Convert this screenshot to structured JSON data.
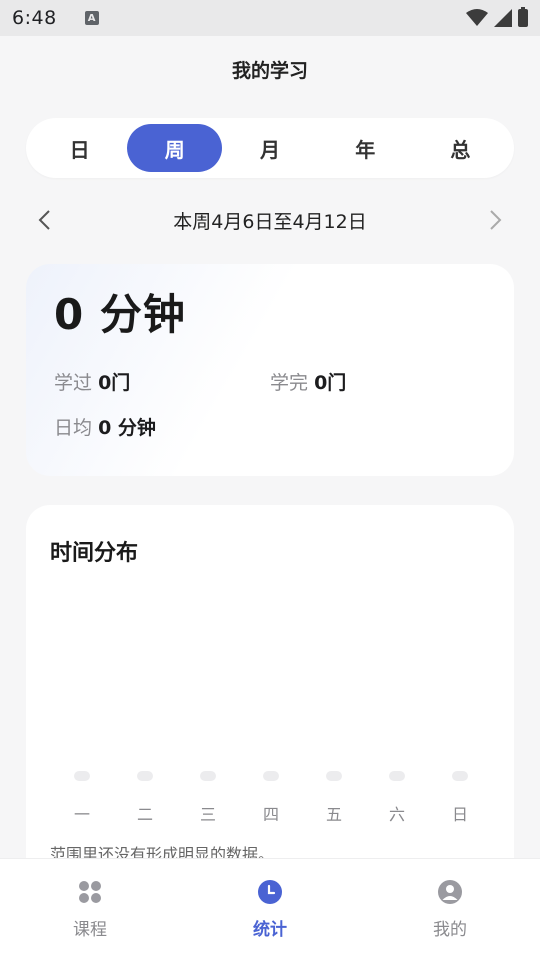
{
  "status_bar": {
    "time": "6:48",
    "notification_letter": "A"
  },
  "header": {
    "title": "我的学习"
  },
  "period_tabs": [
    {
      "label": "日",
      "active": false
    },
    {
      "label": "周",
      "active": true
    },
    {
      "label": "月",
      "active": false
    },
    {
      "label": "年",
      "active": false
    },
    {
      "label": "总",
      "active": false
    }
  ],
  "date_nav": {
    "range_label": "本周4月6日至4月12日"
  },
  "summary": {
    "total_label": "0 分钟",
    "studied_label": "学过",
    "studied_value": "0门",
    "completed_label": "学完",
    "completed_value": "0门",
    "daily_avg_label": "日均",
    "daily_avg_value": "0 分钟"
  },
  "distribution": {
    "title": "时间分布",
    "days": [
      "一",
      "二",
      "三",
      "四",
      "五",
      "六",
      "日"
    ],
    "values": [
      0,
      0,
      0,
      0,
      0,
      0,
      0
    ],
    "empty_note": "范围里还没有形成明显的数据。"
  },
  "bottom_nav": [
    {
      "label": "课程",
      "icon": "grid-icon",
      "active": false
    },
    {
      "label": "统计",
      "icon": "clock-icon",
      "active": true
    },
    {
      "label": "我的",
      "icon": "profile-icon",
      "active": false
    }
  ],
  "colors": {
    "accent": "#4a63d3",
    "muted": "#8a8a8e"
  }
}
